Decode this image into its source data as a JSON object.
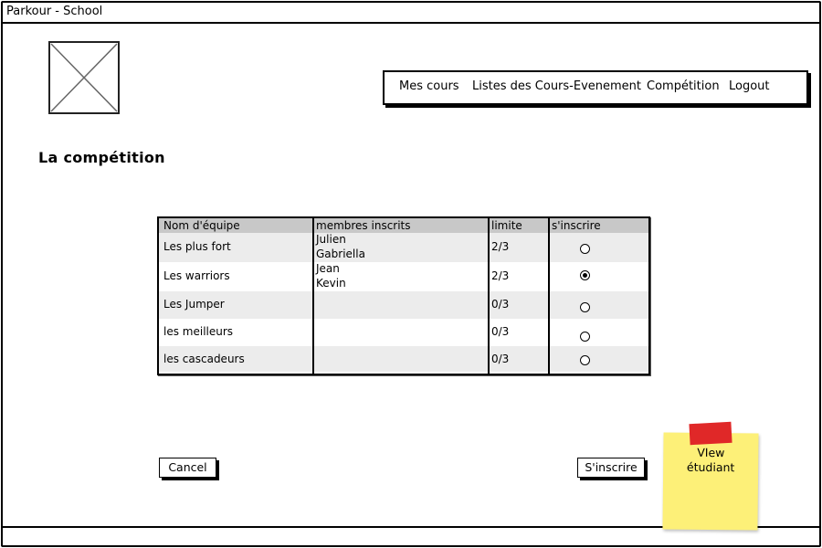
{
  "window": {
    "title": "Parkour - School"
  },
  "nav": {
    "items": [
      {
        "label": "Mes cours"
      },
      {
        "label": "Listes des Cours-Evenement"
      },
      {
        "label": "Compétition"
      },
      {
        "label": "Logout"
      }
    ]
  },
  "page": {
    "title": "La compétition"
  },
  "table": {
    "headers": [
      "Nom d'équipe",
      "membres inscrits",
      "limite",
      "s'inscrire"
    ],
    "rows": [
      {
        "team": "Les  plus fort",
        "members": [
          "Julien",
          "Gabriella"
        ],
        "limit": "2/3",
        "selected": false
      },
      {
        "team": "Les warriors",
        "members": [
          "Jean",
          " Kevin"
        ],
        "limit": "2/3",
        "selected": true
      },
      {
        "team": "Les Jumper",
        "members": [],
        "limit": "0/3",
        "selected": false
      },
      {
        "team": "les meilleurs",
        "members": [],
        "limit": "0/3",
        "selected": false
      },
      {
        "team": "les cascadeurs",
        "members": [],
        "limit": "0/3",
        "selected": false
      }
    ]
  },
  "buttons": {
    "cancel": "Cancel",
    "subscribe": "S'inscrire"
  },
  "sticky_note": {
    "text": "VIew\nétudiant",
    "color": "#fdf078",
    "tape_color": "#e02828"
  },
  "colors": {
    "header_bg": "#c8c8c8",
    "alt_row_bg": "#ececec"
  }
}
